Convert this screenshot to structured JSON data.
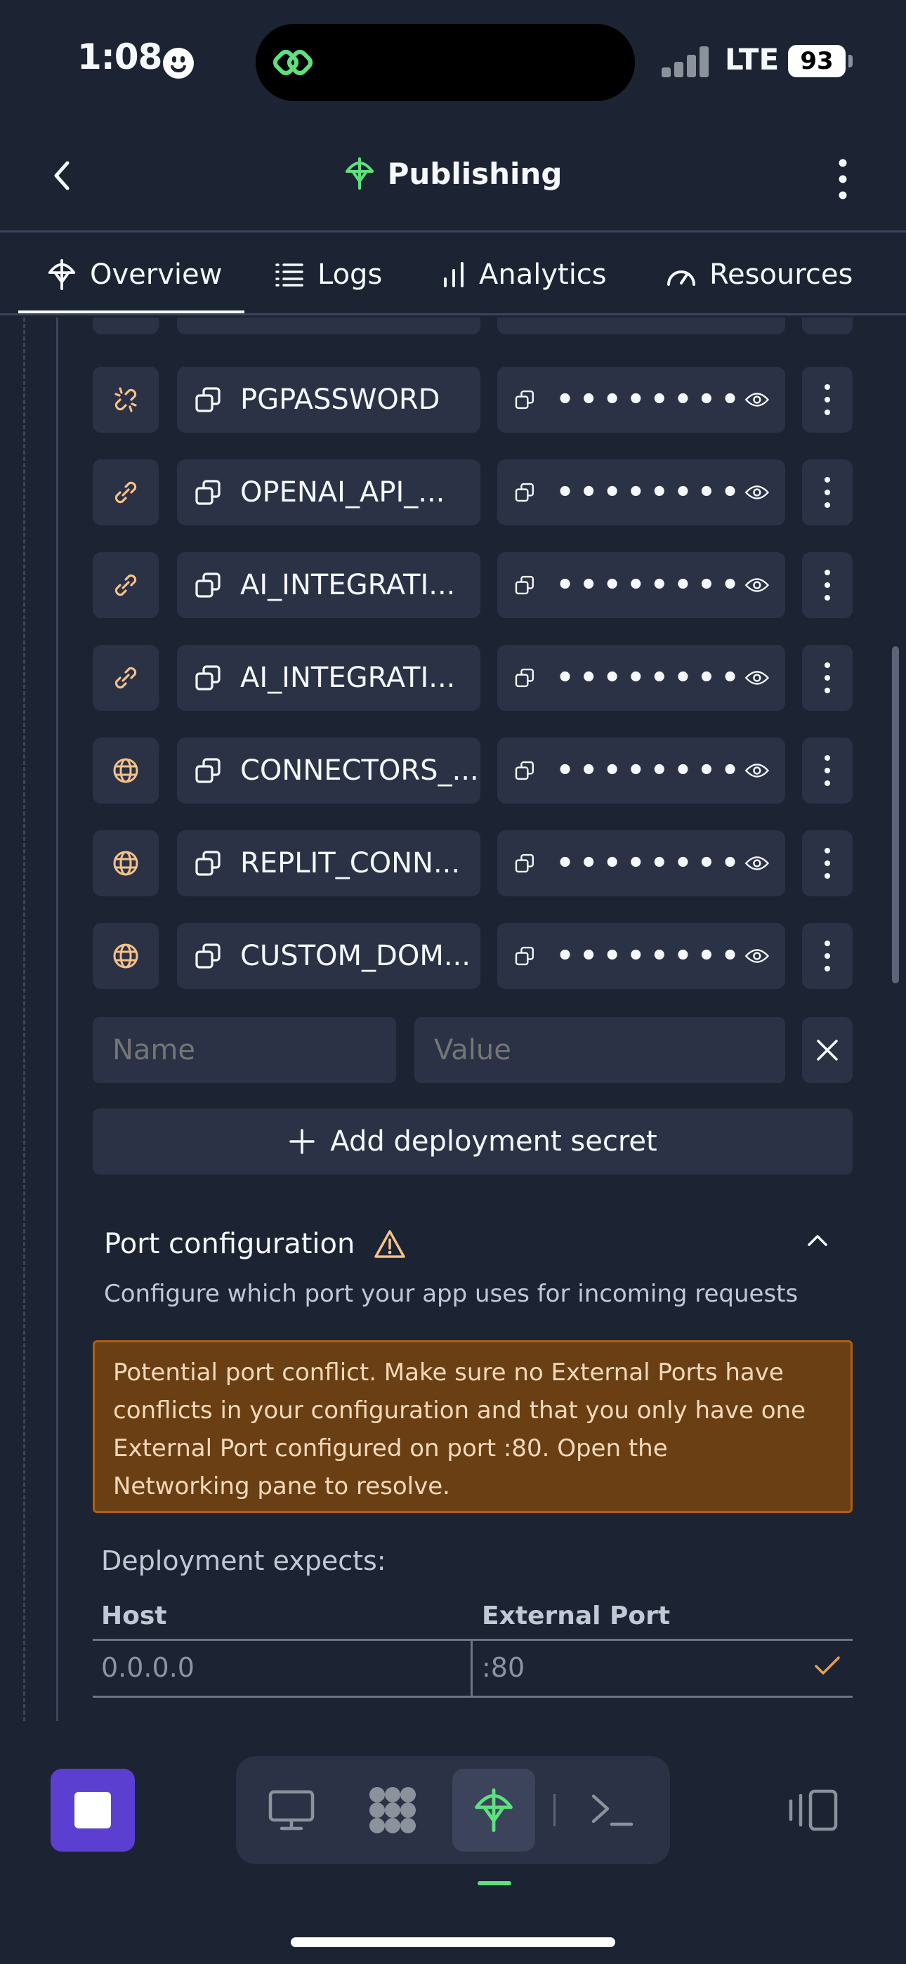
{
  "status_bar": {
    "time": "1:08",
    "network": "LTE",
    "battery": "93"
  },
  "header": {
    "title": "Publishing"
  },
  "tabs": [
    {
      "label": "Overview"
    },
    {
      "label": "Logs"
    },
    {
      "label": "Analytics"
    },
    {
      "label": "Resources"
    }
  ],
  "secrets": [
    {
      "icon": "broken-link-icon",
      "name": "PGPASSWORD",
      "value_masked": "••••••••"
    },
    {
      "icon": "link-icon",
      "name": "OPENAI_API_...",
      "value_masked": "••••••••"
    },
    {
      "icon": "link-icon",
      "name": "AI_INTEGRATI...",
      "value_masked": "••••••••"
    },
    {
      "icon": "link-icon",
      "name": "AI_INTEGRATI...",
      "value_masked": "••••••••"
    },
    {
      "icon": "globe-icon",
      "name": "CONNECTORS_...",
      "value_masked": "••••••••"
    },
    {
      "icon": "globe-icon",
      "name": "REPLIT_CONN...",
      "value_masked": "••••••••"
    },
    {
      "icon": "globe-icon",
      "name": "CUSTOM_DOM...",
      "value_masked": "••••••••"
    }
  ],
  "new_secret": {
    "name_placeholder": "Name",
    "value_placeholder": "Value"
  },
  "add_secret_label": "Add deployment secret",
  "port_config": {
    "title": "Port configuration",
    "subtitle": "Configure which port your app uses for incoming requests",
    "warning_lines": [
      "Potential port conflict. Make sure no External Ports have",
      "conflicts in your configuration and that you only have one",
      "External Port configured on port :80. Open the",
      "Networking pane to resolve."
    ],
    "expects_label": "Deployment expects:",
    "table": {
      "headers": [
        "Host",
        "External Port"
      ],
      "row": [
        "0.0.0.0",
        ":80"
      ]
    }
  },
  "colors": {
    "background": "#1c2333",
    "surface": "#2b3245",
    "accent_icon": "#f5c28a",
    "warning_bg": "#6b3f14",
    "stop_button": "#5b3fd1",
    "active_green": "#5ee07e"
  }
}
